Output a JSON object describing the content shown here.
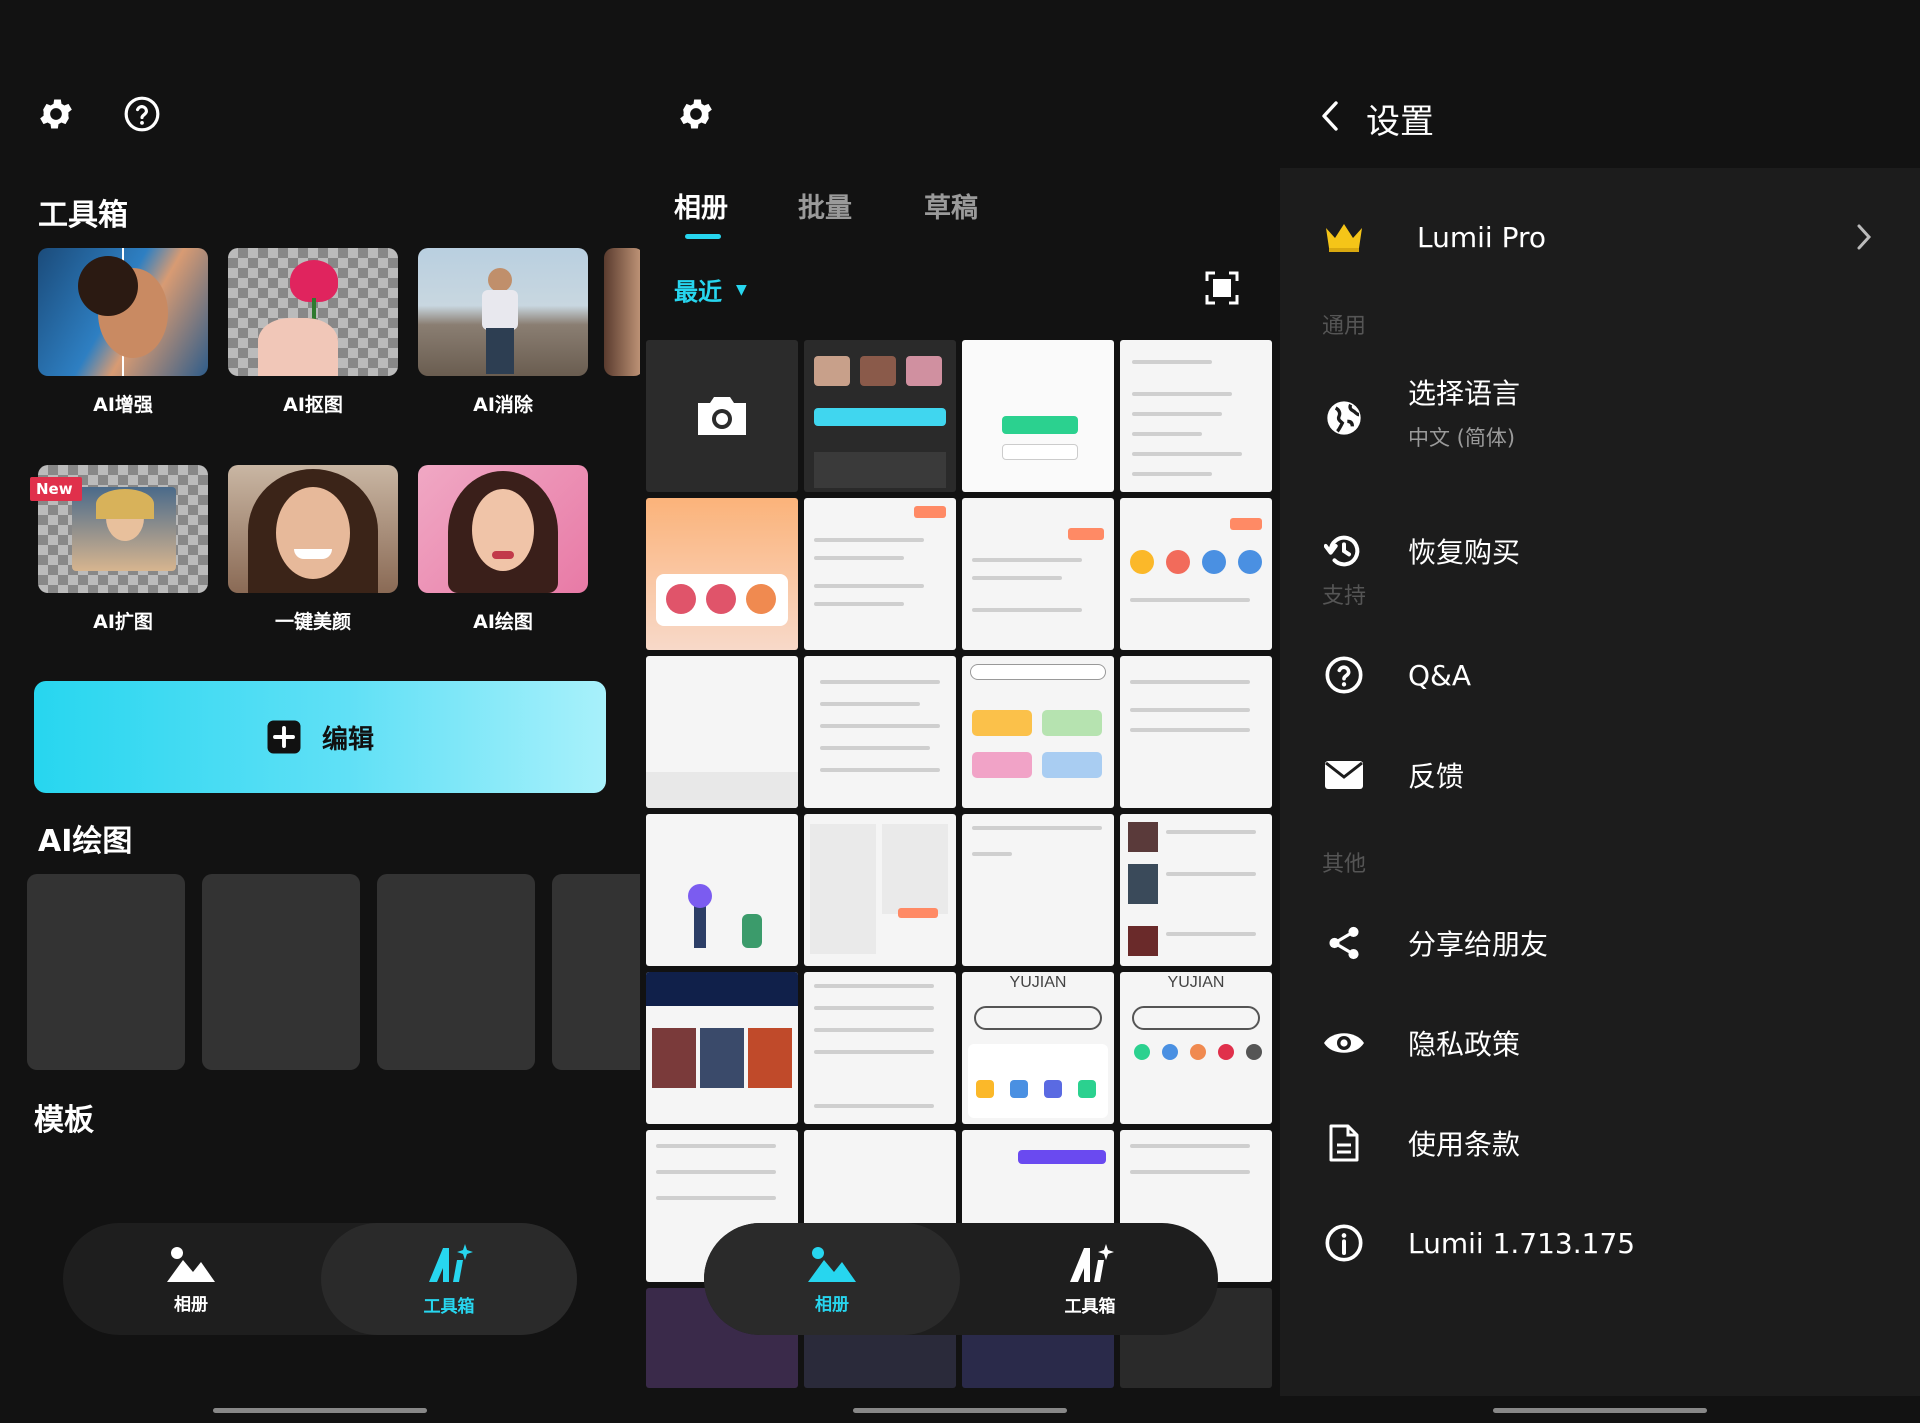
{
  "toolbox_screen": {
    "toolbox_title": "工具箱",
    "tools": [
      {
        "label": "AI增强"
      },
      {
        "label": "AI抠图"
      },
      {
        "label": "AI消除"
      },
      {
        "label": "AI扩图",
        "badge": "New"
      },
      {
        "label": "一键美颜"
      },
      {
        "label": "AI绘图"
      }
    ],
    "edit_button": "编辑",
    "ai_draw_title": "AI绘图",
    "template_title": "模板",
    "nav": {
      "album": "相册",
      "toolbox": "工具箱"
    }
  },
  "album_screen": {
    "tabs": [
      "相册",
      "批量",
      "草稿"
    ],
    "filter": "最近",
    "grid_texts": {
      "yujian1": "YUJIAN",
      "yujian2": "YUJIAN"
    },
    "nav": {
      "album": "相册",
      "toolbox": "工具箱"
    }
  },
  "settings_screen": {
    "title": "设置",
    "pro": "Lumii Pro",
    "group_general": "通用",
    "language_label": "选择语言",
    "language_value": "中文 (简体)",
    "restore": "恢复购买",
    "group_support": "支持",
    "qa": "Q&A",
    "feedback": "反馈",
    "group_other": "其他",
    "share": "分享给朋友",
    "privacy": "隐私政策",
    "terms": "使用条款",
    "version": "Lumii 1.713.175"
  },
  "colors": {
    "accent": "#27d6ef",
    "background": "#121212",
    "settings_card": "#1c1c1c",
    "crown": "#f5c518"
  }
}
